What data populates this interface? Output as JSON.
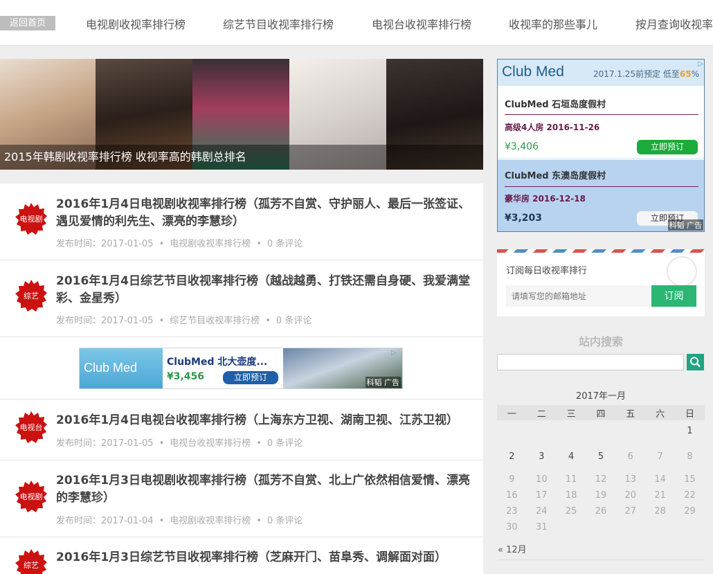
{
  "nav": {
    "home": "返回首页",
    "items": [
      "电视剧收视率排行榜",
      "综艺节目收视率排行榜",
      "电视台收视率排行榜",
      "收视率的那些事儿",
      "按月查询收视率"
    ]
  },
  "banner": {
    "caption": "2015年韩剧收视率排行榜 收视率高的韩剧总排名"
  },
  "posts": [
    {
      "badge": "电视剧",
      "title": "2016年1月4日电视剧收视率排行榜（孤芳不自赏、守护丽人、最后一张签证、遇见爱情的利先生、漂亮的李慧珍）",
      "date": "发布时间：2017-01-05",
      "category": "电视剧收视率排行榜",
      "comments": "0 条评论"
    },
    {
      "badge": "综艺",
      "title": "2016年1月4日综艺节目收视率排行榜（越战越勇、打铁还需自身硬、我爱满堂彩、金星秀）",
      "date": "发布时间：2017-01-05",
      "category": "综艺节目收视率排行榜",
      "comments": "0 条评论"
    },
    {
      "badge": "电视台",
      "title": "2016年1月4日电视台收视率排行榜（上海东方卫视、湖南卫视、江苏卫视）",
      "date": "发布时间：2017-01-05",
      "category": "电视台收视率排行榜",
      "comments": "0 条评论"
    },
    {
      "badge": "电视剧",
      "title": "2016年1月3日电视剧收视率排行榜（孤芳不自赏、北上广依然相信爱情、漂亮的李慧珍）",
      "date": "发布时间：2017-01-04",
      "category": "电视剧收视率排行榜",
      "comments": "0 条评论"
    },
    {
      "badge": "综艺",
      "title": "2016年1月3日综艺节目收视率排行榜（芝麻开门、苗阜秀、调解面对面）",
      "date": "",
      "category": "",
      "comments": ""
    }
  ],
  "inline_ad": {
    "brand": "Club Med",
    "title": "ClubMed 北大壶度...",
    "price": "¥3,456",
    "cta": "立即预订",
    "tag": "科韬 广告"
  },
  "side_ad": {
    "brand": "Club Med",
    "promo_prefix": "2017.1.25前预定 低至",
    "promo_pct": "65",
    "tag": "科韬 广告",
    "offers": [
      {
        "name": "ClubMed 石垣岛度假村",
        "room": "高级4人房 2016-11-26",
        "price": "¥3,406",
        "cta": "立即预订"
      },
      {
        "name": "ClubMed 东澳岛度假村",
        "room": "豪华房 2016-12-18",
        "price": "¥3,203",
        "cta": "立即预订"
      }
    ]
  },
  "subscribe": {
    "label": "订阅每日收视率排行",
    "placeholder": "请填写您的邮箱地址",
    "button": "订阅"
  },
  "search": {
    "title": "站内搜索"
  },
  "calendar": {
    "caption": "2017年一月",
    "weekdays": [
      "一",
      "二",
      "三",
      "四",
      "五",
      "六",
      "日"
    ],
    "weeks": [
      [
        "",
        "",
        "",
        "",
        "",
        "",
        "1"
      ],
      [
        "2",
        "3",
        "4",
        "5",
        "6",
        "7",
        "8"
      ],
      [
        "9",
        "10",
        "11",
        "12",
        "13",
        "14",
        "15"
      ],
      [
        "16",
        "17",
        "18",
        "19",
        "20",
        "21",
        "22"
      ],
      [
        "23",
        "24",
        "25",
        "26",
        "27",
        "28",
        "29"
      ],
      [
        "30",
        "31",
        "",
        "",
        "",
        "",
        ""
      ]
    ],
    "prev": "« 12月"
  },
  "colors": {
    "accent_green": "#2bb673",
    "badge_red": "#cc1111",
    "search_green": "#21a481"
  }
}
